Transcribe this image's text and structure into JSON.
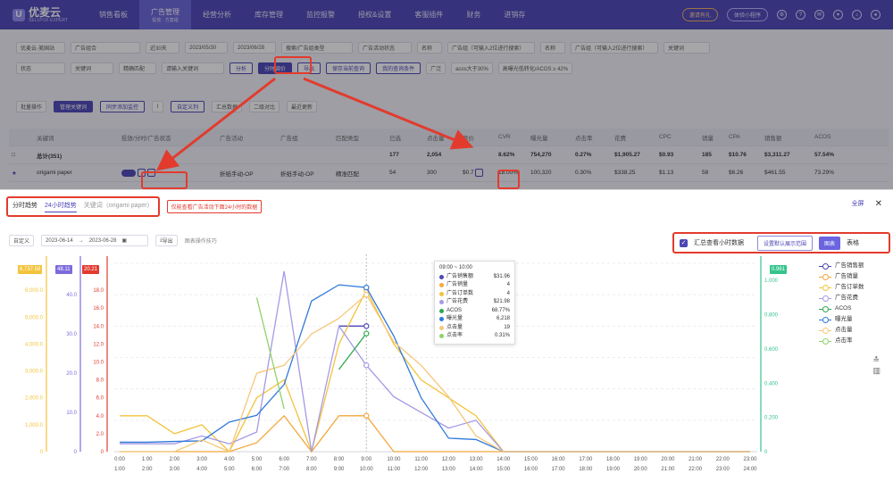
{
  "app": {
    "logo_text": "优麦云",
    "logo_sub": "SELLFOX·EXPERT"
  },
  "nav": [
    "销售看板",
    "广告管理",
    "经营分析",
    "库存管理",
    "监控报警",
    "授权&设置",
    "客服插件",
    "财务",
    "进销存"
  ],
  "nav_active_sub": "投放 · 方案组",
  "top_right": {
    "invite": "邀请有礼",
    "trial": "体验小程序"
  },
  "filters": {
    "row1": [
      "优麦云·美国站",
      "广告组合",
      "近30天",
      "2023/05/30",
      "2023/06/28",
      "搜索/广告组类型",
      "广告活动状态",
      "名称",
      "广告组（可输入2位进行搜索）",
      "名称",
      "广告组（可输入2位进行搜索）",
      "关键词"
    ],
    "row2": [
      "状态",
      "关键词",
      "精确匹配",
      "请输入关键词",
      "分析",
      "分时调价",
      "导出",
      "保存当前查询",
      "我的查询条件",
      "广泛",
      "acos大于30%",
      "高曝光低转化/ACOS ≥ 42%"
    ]
  },
  "toolbar": {
    "batch": "批量操作",
    "add_kw": "管理关键词",
    "sync": "同步添加监控",
    "custom": "自定义列",
    "summary": "汇总数据",
    "compare": "二级对比",
    "last_updated": "最近更新"
  },
  "table": {
    "headers": [
      "",
      "关键词",
      "投放/分时/广告状态",
      "广告活动",
      "广告组",
      "匹配类型",
      "已选",
      "点击量",
      "竞价",
      "CVR",
      "曝光量",
      "点击率",
      "花费",
      "CPC",
      "销量",
      "CPA",
      "销售额",
      "ACOS"
    ],
    "total": [
      "",
      "总计(351)",
      "",
      "",
      "",
      "",
      "177",
      "2,054",
      "",
      "8.62%",
      "754,270",
      "0.27%",
      "$1,905.27",
      "$0.93",
      "185",
      "$10.76",
      "$3,311.27",
      "57.54%"
    ],
    "row": [
      "★",
      "origami paper",
      "",
      "折纸手动-OP",
      "折纸手动-OP",
      "精准匹配",
      "54",
      "300",
      "$0.7",
      "18.00%",
      "100,320",
      "0.30%",
      "$338.25",
      "$1.13",
      "58",
      "$6.26",
      "$461.55",
      "73.29%"
    ]
  },
  "panel": {
    "tabs": [
      "分时趋势",
      "24小时趋势",
      "关键词（origami paper）"
    ],
    "hint": "仅能查看广告活动下面24小时的数据",
    "fullscreen": "全屏",
    "range_type": "自定义",
    "start": "2023-06-14",
    "end": "2023-06-28",
    "export": "导出",
    "tips": "图表操作技巧",
    "summary_check": "汇总查看小时数据",
    "set_default": "设置默认展示范围",
    "chart_btn": "图表",
    "table_btn": "表格"
  },
  "axis_badges": [
    {
      "text": "6,737.58",
      "color": "#f3c33b"
    },
    {
      "text": "48.11",
      "color": "#7c6bdc"
    },
    {
      "text": "20.21",
      "color": "#e23b2e"
    },
    {
      "text": "0.961",
      "color": "#35c48c"
    }
  ],
  "tooltip": {
    "title": "09:00 ~ 10:00",
    "rows": [
      {
        "label": "广告销售额",
        "value": "$31.96",
        "color": "#4b45b5"
      },
      {
        "label": "广告销量",
        "value": "4",
        "color": "#f3a83b"
      },
      {
        "label": "广告订单数",
        "value": "4",
        "color": "#f3c33b"
      },
      {
        "label": "广告花费",
        "value": "$21.98",
        "color": "#a59ae6"
      },
      {
        "label": "ACOS",
        "value": "68.77%",
        "color": "#2fa84f"
      },
      {
        "label": "曝光量",
        "value": "6,218",
        "color": "#2f79d9"
      },
      {
        "label": "点击量",
        "value": "19",
        "color": "#f5c77a"
      },
      {
        "label": "点击率",
        "value": "0.31%",
        "color": "#8fd36b"
      }
    ]
  },
  "chart_data": {
    "type": "line",
    "x_top": [
      "0:00",
      "1:00",
      "2:00",
      "3:00",
      "4:00",
      "5:00",
      "6:00",
      "7:00",
      "8:00",
      "9:00",
      "10:00",
      "11:00",
      "12:00",
      "13:00",
      "14:00",
      "15:00",
      "16:00",
      "17:00",
      "18:00",
      "19:00",
      "20:00",
      "21:00",
      "22:00",
      "23:00"
    ],
    "x_bottom": [
      "1:00",
      "2:00",
      "3:00",
      "4:00",
      "5:00",
      "6:00",
      "7:00",
      "8:00",
      "9:00",
      "10:00",
      "11:00",
      "12:00",
      "13:00",
      "14:00",
      "15:00",
      "16:00",
      "17:00",
      "18:00",
      "19:00",
      "20:00",
      "21:00",
      "22:00",
      "23:00",
      "24:00"
    ],
    "axes": {
      "left1": {
        "ticks": [
          "0",
          "1,000.0",
          "2,000.0",
          "3,000.0",
          "4,000.0",
          "5,000.0",
          "6,000.0"
        ],
        "color": "#f3c33b",
        "max": 7000
      },
      "left2": {
        "ticks": [
          "0",
          "10.0",
          "20.0",
          "30.0",
          "40.0"
        ],
        "color": "#7c6bdc",
        "max": 48
      },
      "left3": {
        "ticks": [
          "0",
          "2.0",
          "4.0",
          "6.0",
          "8.0",
          "10.0",
          "12.0",
          "14.0",
          "16.0",
          "18.0"
        ],
        "color": "#e23b2e",
        "max": 21
      },
      "right": {
        "ticks": [
          "0",
          "0.200",
          "0.400",
          "0.600",
          "0.800",
          "1.000"
        ],
        "color": "#35c48c",
        "max": 1.1
      }
    },
    "series": [
      {
        "name": "广告销售额",
        "color": "#4b45b5",
        "axis": "left2",
        "values": [
          null,
          null,
          null,
          null,
          null,
          null,
          null,
          null,
          32,
          32,
          null,
          null,
          null,
          null,
          null,
          null,
          null,
          null,
          null,
          null,
          null,
          null,
          null,
          null
        ]
      },
      {
        "name": "广告销量",
        "color": "#f3a83b",
        "axis": "left3",
        "values": [
          0,
          0,
          0,
          0,
          0,
          1,
          4,
          0,
          4,
          4,
          0,
          0,
          0,
          0,
          0,
          0,
          0,
          0,
          0,
          0,
          0,
          0,
          0,
          0
        ]
      },
      {
        "name": "广告订单数",
        "color": "#f3c33b",
        "axis": "left3",
        "values": [
          4,
          4,
          2,
          3,
          0,
          6,
          8,
          0,
          12,
          18,
          12,
          8,
          6,
          4,
          0,
          0,
          0,
          0,
          0,
          0,
          0,
          0,
          0,
          0
        ]
      },
      {
        "name": "广告花费",
        "color": "#a59ae6",
        "axis": "left2",
        "values": [
          2,
          2,
          2,
          4,
          2,
          5,
          46,
          0,
          32,
          22,
          14,
          10,
          6,
          8,
          0,
          0,
          0,
          0,
          0,
          0,
          0,
          0,
          0,
          0
        ]
      },
      {
        "name": "ACOS",
        "color": "#2fa84f",
        "axis": "right",
        "values": [
          null,
          null,
          null,
          null,
          null,
          null,
          null,
          null,
          0.48,
          0.69,
          null,
          null,
          null,
          null,
          null,
          null,
          null,
          null,
          null,
          null,
          null,
          null,
          null,
          null
        ]
      },
      {
        "name": "曝光量",
        "color": "#2f79d9",
        "axis": "left1",
        "values": [
          350,
          350,
          380,
          400,
          1100,
          1350,
          2500,
          5600,
          6200,
          6100,
          4300,
          2000,
          500,
          450,
          0,
          0,
          0,
          0,
          0,
          0,
          0,
          0,
          0,
          0
        ]
      },
      {
        "name": "点击量",
        "color": "#f5c77a",
        "axis": "left2",
        "values": [
          0,
          0,
          0,
          3,
          0,
          20,
          22,
          30,
          34,
          40,
          28,
          22,
          14,
          4,
          0,
          0,
          0,
          0,
          0,
          0,
          0,
          0,
          0,
          0
        ]
      },
      {
        "name": "点击率",
        "color": "#8fd36b",
        "axis": "right",
        "values": [
          null,
          null,
          null,
          null,
          null,
          0.9,
          0.25,
          null,
          null,
          null,
          null,
          null,
          null,
          null,
          null,
          null,
          null,
          null,
          null,
          null,
          null,
          null,
          null,
          null
        ]
      }
    ]
  }
}
